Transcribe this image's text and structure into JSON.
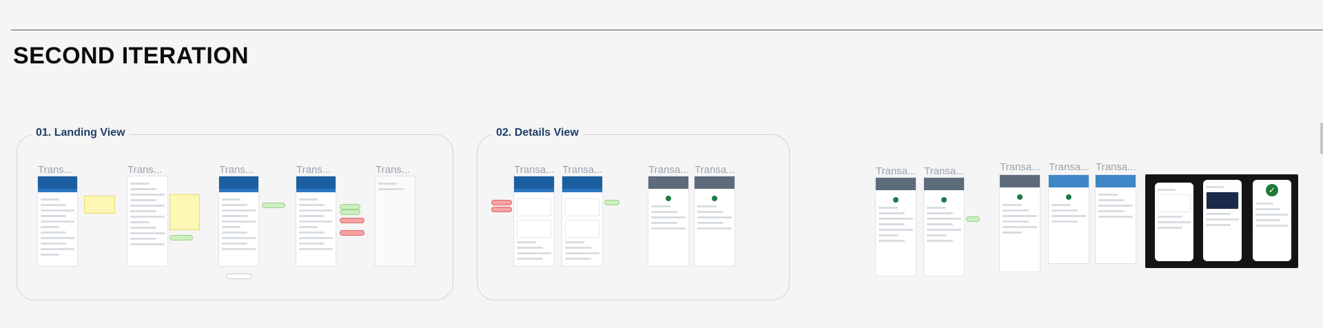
{
  "page": {
    "title": "SECOND ITERATION"
  },
  "sections": [
    {
      "label": "01. Landing View"
    },
    {
      "label": "02. Details View"
    }
  ],
  "frame_names": {
    "landing": [
      "Trans...",
      "Trans...",
      "Trans...",
      "Trans...",
      "Trans..."
    ],
    "details": [
      "Transa...",
      "Transa...",
      "Transa...",
      "Transa..."
    ],
    "extra": [
      "Transa...",
      "Transa...",
      "Transa...",
      "Transa...",
      "Transa..."
    ]
  },
  "colors": {
    "accent": "#1f3e66",
    "app_header": "#1c5fa0",
    "note": "#fdf7b5",
    "tag_green": "#cdeec1",
    "tag_red": "#f5a3a3"
  }
}
